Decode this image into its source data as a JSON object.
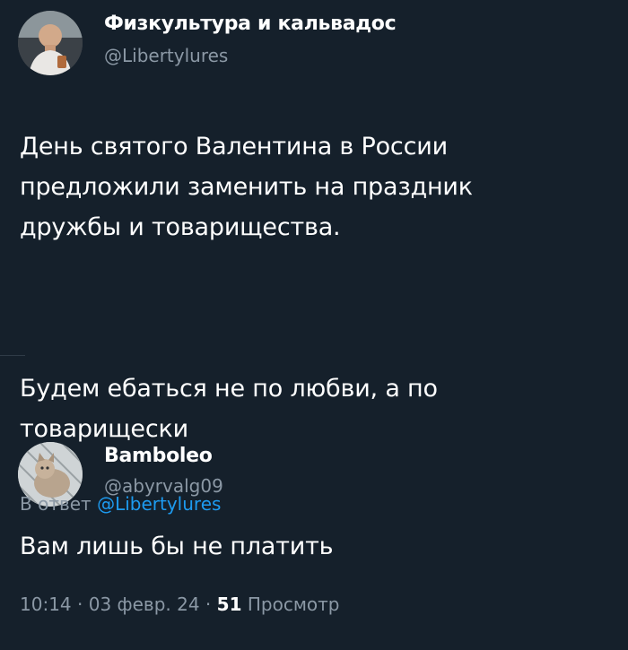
{
  "tweet": {
    "author_name": "Физкультура и кальвадос",
    "author_handle": "@Libertylures",
    "paragraph_1": "День святого Валентина в России\nпредложили заменить на праздник\nдружбы и товарищества.",
    "paragraph_2": "Будем ебаться не по любви, а по\nтоварищески"
  },
  "reply": {
    "author_name": "Bamboleo",
    "author_handle": "@abyrvalg09",
    "reply_prefix": "В ответ",
    "reply_mention": "@Libertylures",
    "text": "Вам лишь бы не платить",
    "time": "10:14",
    "sep1": " · ",
    "date": "03 февр. 24",
    "sep2": " · ",
    "views_count": "51",
    "views_label": "Просмотр"
  },
  "colors": {
    "background": "#15202b",
    "primary_text": "#ffffff",
    "secondary_text": "#8b98a5",
    "link": "#1d9bf0"
  },
  "icons": {
    "avatar_1": "profile-photo-man",
    "avatar_2": "profile-photo-cat"
  }
}
